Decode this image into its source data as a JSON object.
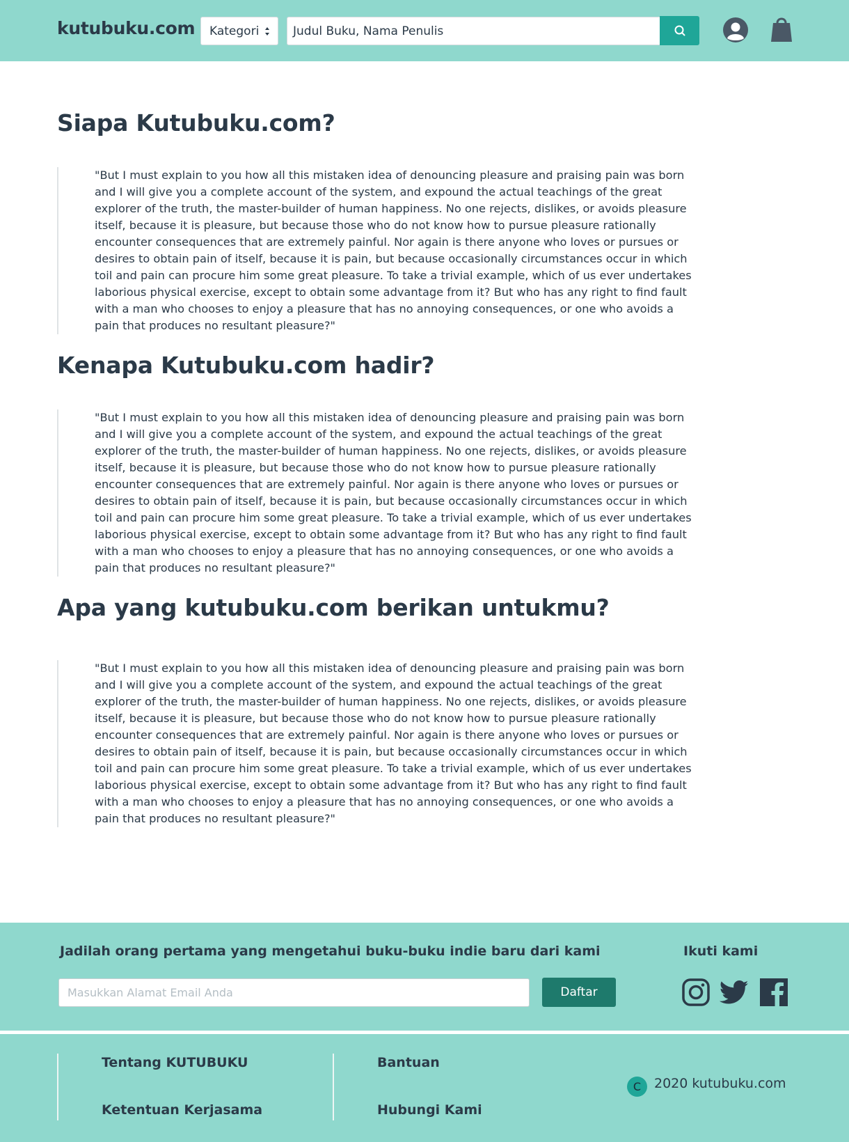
{
  "header": {
    "logo": "kutubuku.com",
    "category_select": "Kategori",
    "search_value": "Judul Buku, Nama Penulis"
  },
  "sections": [
    {
      "title": "Siapa Kutubuku.com?",
      "quote": "\"But I must explain to you how all this mistaken idea of denouncing pleasure and praising pain was born and I will give you a complete account of the system, and expound the actual teachings of the great explorer of the truth, the master-builder of human happiness. No one rejects, dislikes, or avoids pleasure itself, because it is pleasure, but because those who do not know how to pursue pleasure rationally encounter consequences that are extremely painful. Nor again is there anyone who loves or pursues or desires to obtain pain of itself, because it is pain, but because occasionally circumstances occur in which toil and pain can procure him some great pleasure. To take a trivial example, which of us ever undertakes laborious physical exercise, except to obtain some advantage from it? But who has any right to find fault with a man who chooses to enjoy a pleasure that has no annoying consequences, or one who avoids a pain that produces no resultant pleasure?\""
    },
    {
      "title": "Kenapa Kutubuku.com hadir?",
      "quote": "\"But I must explain to you how all this mistaken idea of denouncing pleasure and praising pain was born and I will give you a complete account of the system, and expound the actual teachings of the great explorer of the truth, the master-builder of human happiness. No one rejects, dislikes, or avoids pleasure itself, because it is pleasure, but because those who do not know how to pursue pleasure rationally encounter consequences that are extremely painful. Nor again is there anyone who loves or pursues or desires to obtain pain of itself, because it is pain, but because occasionally circumstances occur in which toil and pain can procure him some great pleasure. To take a trivial example, which of us ever undertakes laborious physical exercise, except to obtain some advantage from it? But who has any right to find fault with a man who chooses to enjoy a pleasure that has no annoying consequences, or one who avoids a pain that produces no resultant pleasure?\""
    },
    {
      "title": "Apa yang kutubuku.com berikan untukmu?",
      "quote": "\"But I must explain to you how all this mistaken idea of denouncing pleasure and praising pain was born and I will give you a complete account of the system, and expound the actual teachings of the great explorer of the truth, the master-builder of human happiness. No one rejects, dislikes, or avoids pleasure itself, because it is pleasure, but because those who do not know how to pursue pleasure rationally encounter consequences that are extremely painful. Nor again is there anyone who loves or pursues or desires to obtain pain of itself, because it is pain, but because occasionally circumstances occur in which toil and pain can procure him some great pleasure. To take a trivial example, which of us ever undertakes laborious physical exercise, except to obtain some advantage from it? But who has any right to find fault with a man who chooses to enjoy a pleasure that has no annoying consequences, or one who avoids a pain that produces no resultant pleasure?\""
    }
  ],
  "newsletter": {
    "title": "Jadilah orang pertama yang mengetahui buku-buku indie baru dari kami",
    "email_placeholder": "Masukkan Alamat Email Anda",
    "button": "Daftar",
    "follow_title": "Ikuti kami",
    "social_icons": [
      "instagram-icon",
      "twitter-icon",
      "facebook-icon"
    ]
  },
  "footer": {
    "links": [
      "Tentang KUTUBUKU",
      "Ketentuan Kerjasama",
      "Bantuan",
      "Hubungi Kami"
    ],
    "copyright_badge": "C",
    "copyright": "2020 kutubuku.com"
  },
  "colors": {
    "teal_light": "#8fd8cd",
    "teal_accent": "#1fa698",
    "teal_dark": "#1e7a6c",
    "text_dark": "#2b3a48"
  }
}
